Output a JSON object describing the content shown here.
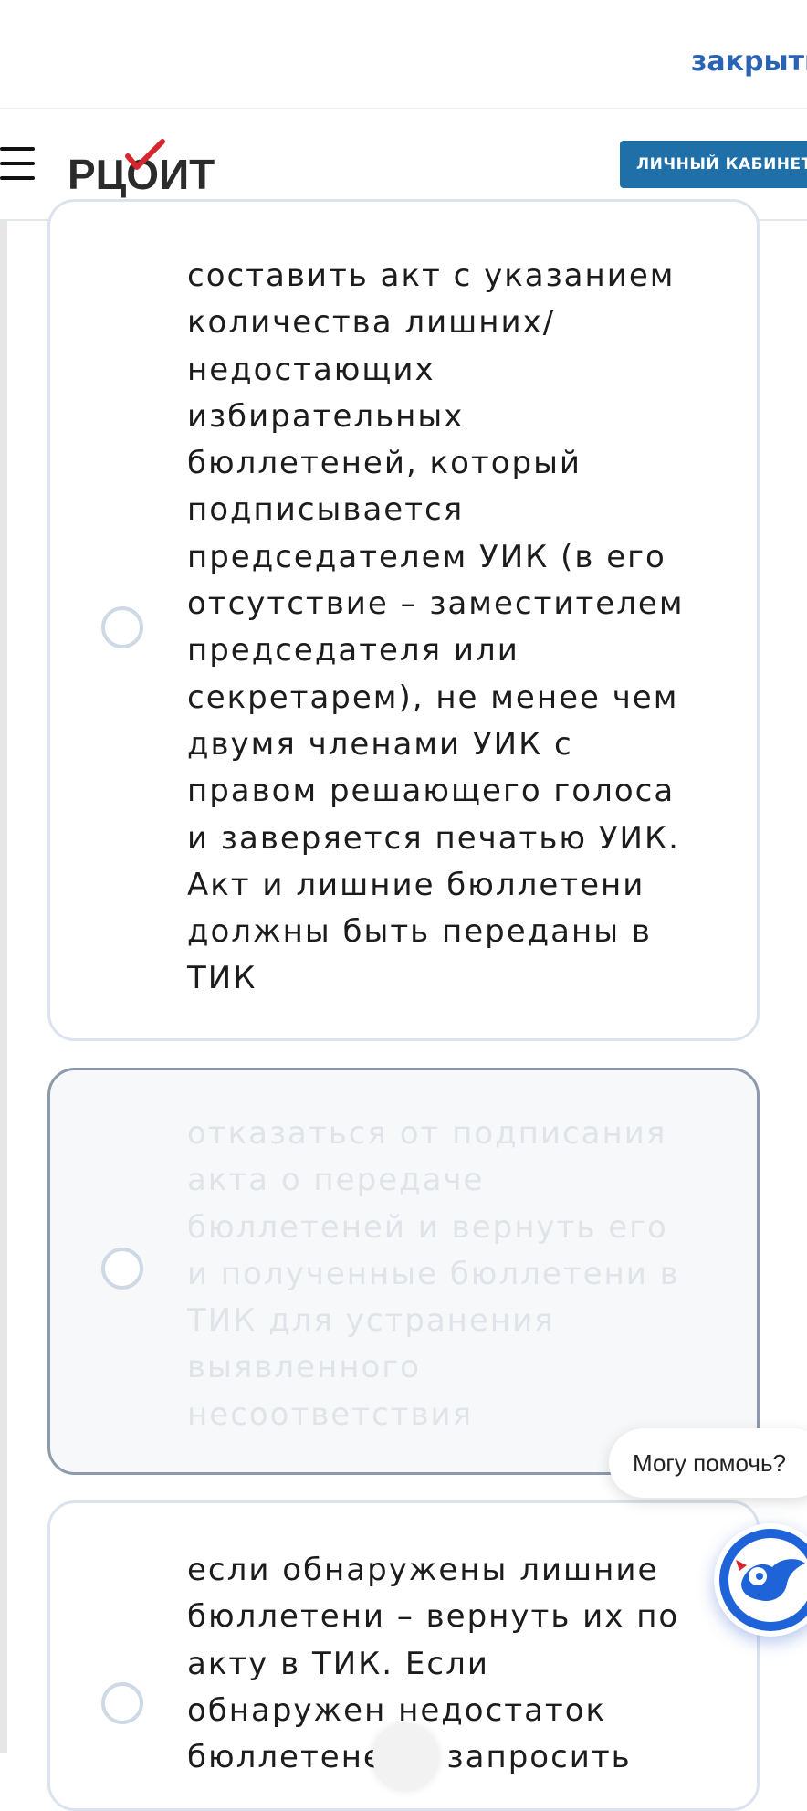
{
  "topbar": {
    "close_label": "закрыть"
  },
  "header": {
    "logo_text": "РЦОИТ",
    "cabinet_button": "ЛИЧНЫЙ КАБИНЕТ"
  },
  "options": [
    {
      "text": "составить акт с указанием\nколичества лишних/\nнедостающих\nизбирательных\nбюллетеней, который\nподписывается\nпредседателем УИК (в его\nотсутствие – заместителем\nпредседателя или\nсекретарем), не менее чем\nдвумя членами УИК с\nправом решающего голоса\nи заверяется печатью УИК.\nАкт и лишние бюллетени\nдолжны быть переданы в\nТИК",
      "selected": false,
      "disabled": false
    },
    {
      "text": "отказаться от подписания\nакта о передаче\nбюллетеней и вернуть его\nи полученные бюллетени в\nТИК для устранения\nвыявленного\nнесоответствия",
      "selected": false,
      "disabled": true
    },
    {
      "text": "если обнаружены лишние\nбюллетени – вернуть их по\nакту в ТИК. Если\nобнаружен недостаток\nбюллетеней – запросить",
      "selected": false,
      "disabled": false
    }
  ],
  "assistant": {
    "bubble_text": "Могу помочь?"
  },
  "colors": {
    "accent": "#2a63b4",
    "button": "#1f6fa8",
    "logo_check": "#d8262e",
    "assistant_ring": "#1f63d8"
  }
}
